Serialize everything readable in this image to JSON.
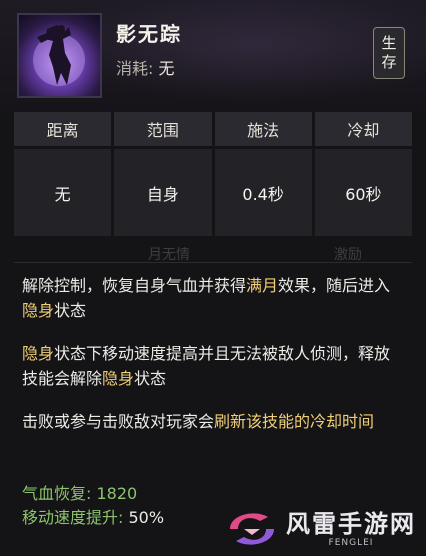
{
  "skill": {
    "name": "影无踪",
    "cost_label": "消耗:",
    "cost_value": "无",
    "tag_chars": [
      "生",
      "存"
    ]
  },
  "stats": [
    {
      "label": "距离",
      "value": "无"
    },
    {
      "label": "范围",
      "value": "自身"
    },
    {
      "label": "施法",
      "value": "0.4秒"
    },
    {
      "label": "冷却",
      "value": "60秒"
    }
  ],
  "faded_labels": [
    "月无情",
    "激励"
  ],
  "description": {
    "p1": {
      "a": "解除控制，恢复自身气血并获得",
      "b": "满月",
      "c": "效果，随后进入",
      "d": "隐身",
      "e": "状态"
    },
    "p2": {
      "a": "隐身",
      "b": "状态下移动速度提高并且无法被敌人侦测，释放技能会解除",
      "c": "隐身",
      "d": "状态"
    },
    "p3": {
      "a": "击败或参与击败敌对玩家会",
      "b": "刷新该技能的冷却时间"
    }
  },
  "attributes": [
    {
      "label": "气血恢复:",
      "value": "1820"
    },
    {
      "label": "移动速度提升:",
      "value": "50%"
    }
  ],
  "watermark": {
    "title": "风雷手游网",
    "subtitle": "FENGLEI"
  },
  "colors": {
    "highlight": "#f0cf76",
    "attribute_green": "#8cc46c",
    "text": "#ecebe6"
  }
}
